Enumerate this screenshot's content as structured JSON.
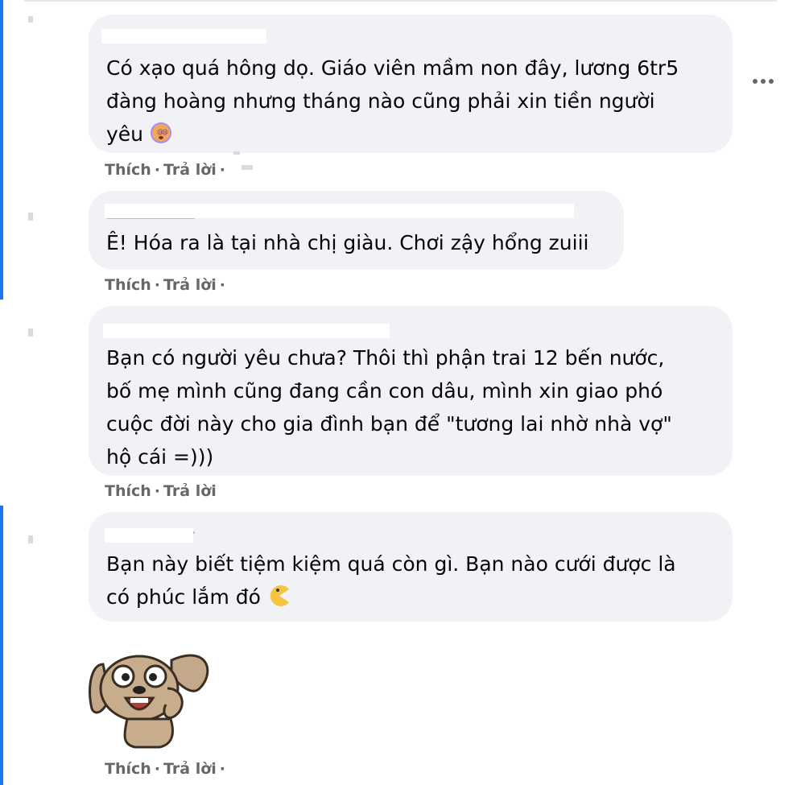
{
  "comments": [
    {
      "text": "Có xạo quá hông dọ. Giáo viên mầm non đây, lương 6tr5\nđàng hoàng nhưng tháng nào cũng phải xin tiền người\nyêu",
      "emoji": "dizzy-face-icon",
      "actions": {
        "like": "Thích",
        "reply": "Trả lời"
      }
    },
    {
      "text": "Ê! Hóa ra là tại nhà chị giàu. Chơi zậy hổng zuiii",
      "actions": {
        "like": "Thích",
        "reply": "Trả lời"
      }
    },
    {
      "text": "Bạn có người yêu chưa? Thôi thì phận trai 12 bến nước,\nbố mẹ mình cũng đang cần con dâu, mình xin giao phó\ncuộc đời này cho gia đình bạn để \"tương lai nhờ nhà vợ\"\nhộ cái =)))",
      "actions": {
        "like": "Thích",
        "reply": "Trả lời"
      }
    },
    {
      "text": "Bạn này biết tiệm kiệm quá còn gì. Bạn nào cưới được là\ncó phúc lắm đó",
      "emoji": "pacman-icon",
      "sticker": "dog-sticker",
      "actions": {
        "like": "Thích",
        "reply": "Trả lời"
      }
    }
  ],
  "colors": {
    "bubble": "#f0f2f5",
    "action": "#65676b",
    "thread": "#1877f2"
  }
}
